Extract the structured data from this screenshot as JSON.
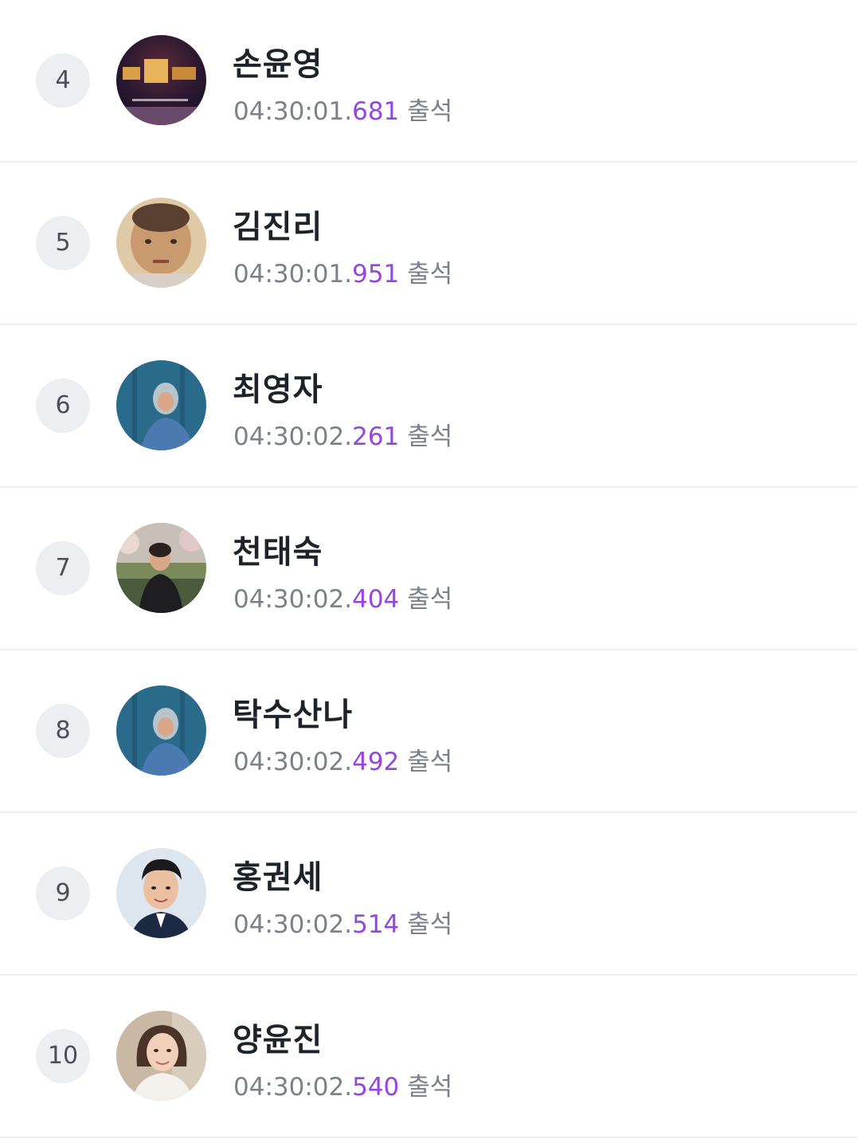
{
  "rows": [
    {
      "rank": "4",
      "name": "손윤영",
      "time_main": "04:30:01.",
      "time_ms": "681",
      "status": "출석",
      "avatar_icon": "book-cover-avatar-icon"
    },
    {
      "rank": "5",
      "name": "김진리",
      "time_main": "04:30:01.",
      "time_ms": "951",
      "status": "출석",
      "avatar_icon": "child-photo-avatar-icon"
    },
    {
      "rank": "6",
      "name": "최영자",
      "time_main": "04:30:02.",
      "time_ms": "261",
      "status": "출석",
      "avatar_icon": "hooded-person-avatar-icon"
    },
    {
      "rank": "7",
      "name": "천태숙",
      "time_main": "04:30:02.",
      "time_ms": "404",
      "status": "출석",
      "avatar_icon": "person-outdoor-avatar-icon"
    },
    {
      "rank": "8",
      "name": "탁수산나",
      "time_main": "04:30:02.",
      "time_ms": "492",
      "status": "출석",
      "avatar_icon": "hooded-person-avatar-icon"
    },
    {
      "rank": "9",
      "name": "홍권세",
      "time_main": "04:30:02.",
      "time_ms": "514",
      "status": "출석",
      "avatar_icon": "man-suit-avatar-icon"
    },
    {
      "rank": "10",
      "name": "양윤진",
      "time_main": "04:30:02.",
      "time_ms": "540",
      "status": "출석",
      "avatar_icon": "woman-portrait-avatar-icon"
    }
  ],
  "colors": {
    "rank_bg": "#eceef1",
    "name": "#1e2229",
    "time": "#7b8089",
    "ms_accent": "#9546e0",
    "divider": "#eceef1"
  }
}
